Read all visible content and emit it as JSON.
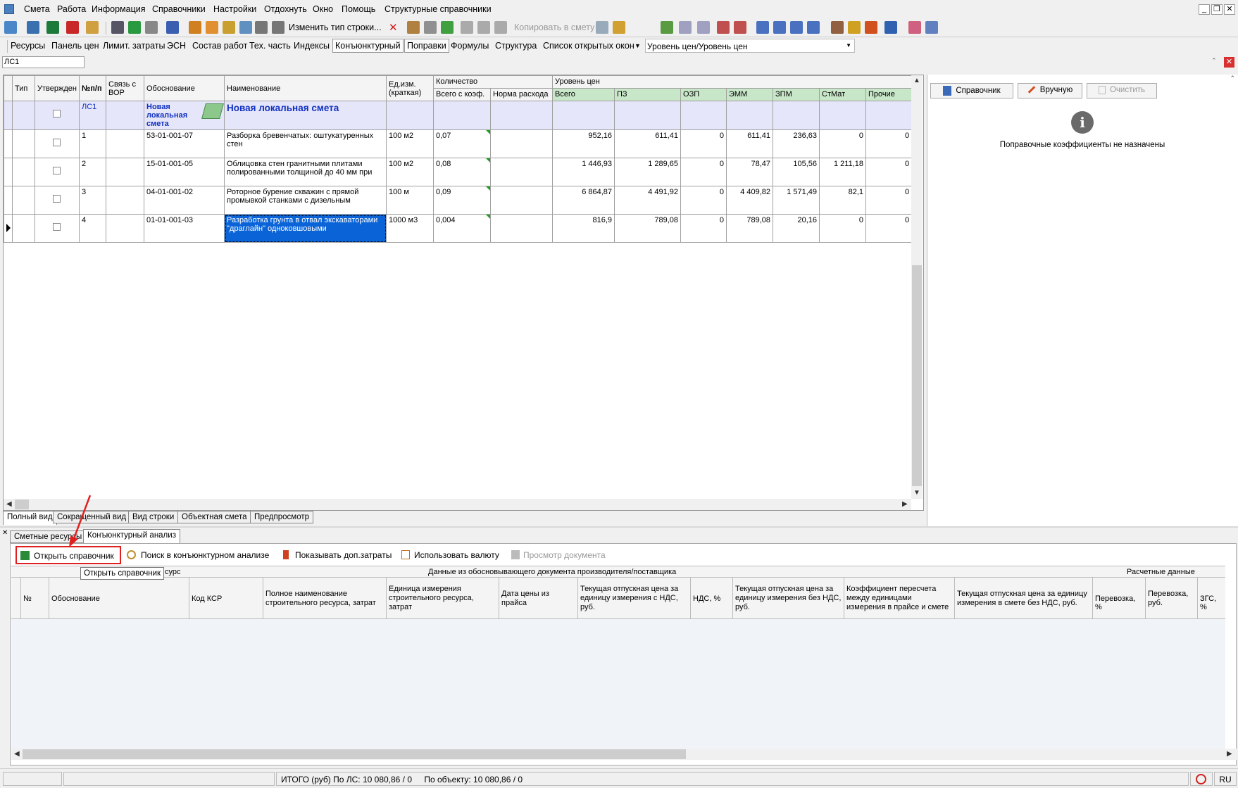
{
  "menu": [
    "Смета",
    "Работа",
    "Информация",
    "Справочники",
    "Настройки",
    "Отдохнуть",
    "Окно",
    "Помощь",
    "Структурные справочники"
  ],
  "toolbar1": {
    "change_row_type": "Изменить тип строки...",
    "copy_to_estimate": "Копировать в смету"
  },
  "toolbar2": {
    "items": [
      "Ресурсы",
      "Панель цен",
      "Лимит. затраты",
      "ЭСН",
      "Состав работ",
      "Тех. часть",
      "Индексы",
      "Конъюнктурный",
      "Поправки",
      "Формулы",
      "Структура",
      "Список открытых окон"
    ],
    "price_level": "Уровень цен/Уровень цен"
  },
  "estimate_selector": "ЛС1",
  "grid": {
    "headers": {
      "type": "Тип",
      "approved": "Утвержден",
      "num": "№п/п",
      "vor_link": "Связь с ВОР",
      "basis": "Обоснование",
      "name": "Наименование",
      "unit": "Ед.изм. (краткая)",
      "quantity": "Количество",
      "qty_total": "Всего с коэф.",
      "qty_norm": "Норма расхода",
      "price_level": "Уровень цен",
      "total": "Всего",
      "pz": "ПЗ",
      "ozp": "ОЗП",
      "emm": "ЭММ",
      "zpm": "ЗПМ",
      "stmat": "СтМат",
      "other": "Прочие"
    },
    "section": {
      "num": "ЛС1",
      "basis": "Новая локальная смета",
      "name": "Новая локальная смета"
    },
    "rows": [
      {
        "num": "1",
        "basis": "53-01-001-07",
        "name": "Разборка бревенчатых: оштукатуренных стен",
        "unit": "100 м2",
        "qty": "0,07",
        "total": "952,16",
        "pz": "611,41",
        "ozp": "0",
        "emm": "611,41",
        "zpm": "236,63",
        "stmat": "0",
        "other": "0"
      },
      {
        "num": "2",
        "basis": "15-01-001-05",
        "name": "Облицовка стен гранитными плитами полированными толщиной до 40 мм при",
        "unit": "100 м2",
        "qty": "0,08",
        "total": "1 446,93",
        "pz": "1 289,65",
        "ozp": "0",
        "emm": "78,47",
        "zpm": "105,56",
        "stmat": "1 211,18",
        "other": "0"
      },
      {
        "num": "3",
        "basis": "04-01-001-02",
        "name": "Роторное бурение скважин с прямой промывкой станками с дизельным",
        "unit": "100 м",
        "qty": "0,09",
        "total": "6 864,87",
        "pz": "4 491,92",
        "ozp": "0",
        "emm": "4 409,82",
        "zpm": "1 571,49",
        "stmat": "82,1",
        "other": "0"
      },
      {
        "num": "4",
        "basis": "01-01-001-03",
        "name": "Разработка грунта в отвал экскаваторами \"драглайн\" одноковшовыми",
        "unit": "1000 м3",
        "qty": "0,004",
        "total": "816,9",
        "pz": "789,08",
        "ozp": "0",
        "emm": "789,08",
        "zpm": "20,16",
        "stmat": "0",
        "other": "0"
      }
    ]
  },
  "right_panel": {
    "btn_reference": "Справочник",
    "btn_manual": "Вручную",
    "btn_clear": "Очистить",
    "message": "Поправочные коэффициенты не назначены"
  },
  "view_tabs": [
    "Полный вид",
    "Сокращенный вид",
    "Вид строки",
    "Объектная смета",
    "Предпросмотр"
  ],
  "bottom_tabs": [
    "Сметные ресурсы",
    "Конъюнктурный анализ"
  ],
  "bottom_toolbar": {
    "open_reference": "Открыть справочник",
    "search": "Поиск в конъюнктурном анализе",
    "show_extra": "Показывать доп.затраты",
    "use_currency": "Использовать валюту",
    "view_doc": "Просмотр документа"
  },
  "tooltip": "Открыть справочник",
  "bottom_grid": {
    "group_resource": "сурс",
    "group_doc": "Данные из обосновывающего документа производителя/поставщика",
    "group_calc": "Расчетные данные",
    "columns": [
      "№",
      "Обоснование",
      "Код КСР",
      "Полное наименование строительного ресурса, затрат",
      "Единица измерения строительного ресурса, затрат",
      "Дата цены из прайса",
      "Текущая отпускная цена за единицу измерения с НДС, руб.",
      "НДС, %",
      "Текущая отпускная цена за единицу измерения без НДС, руб.",
      "Коэффициент пересчета между единицами измерения в прайсе и смете",
      "Текущая отпускная цена за единицу измерения в смете без НДС, руб.",
      "Перевозка, %",
      "Перевозка, руб.",
      "ЗГС, %"
    ]
  },
  "status": {
    "total": "ИТОГО (руб)  По ЛС: 10 080,86 / 0",
    "object": "По объекту: 10 080,86 / 0",
    "lang": "RU"
  }
}
